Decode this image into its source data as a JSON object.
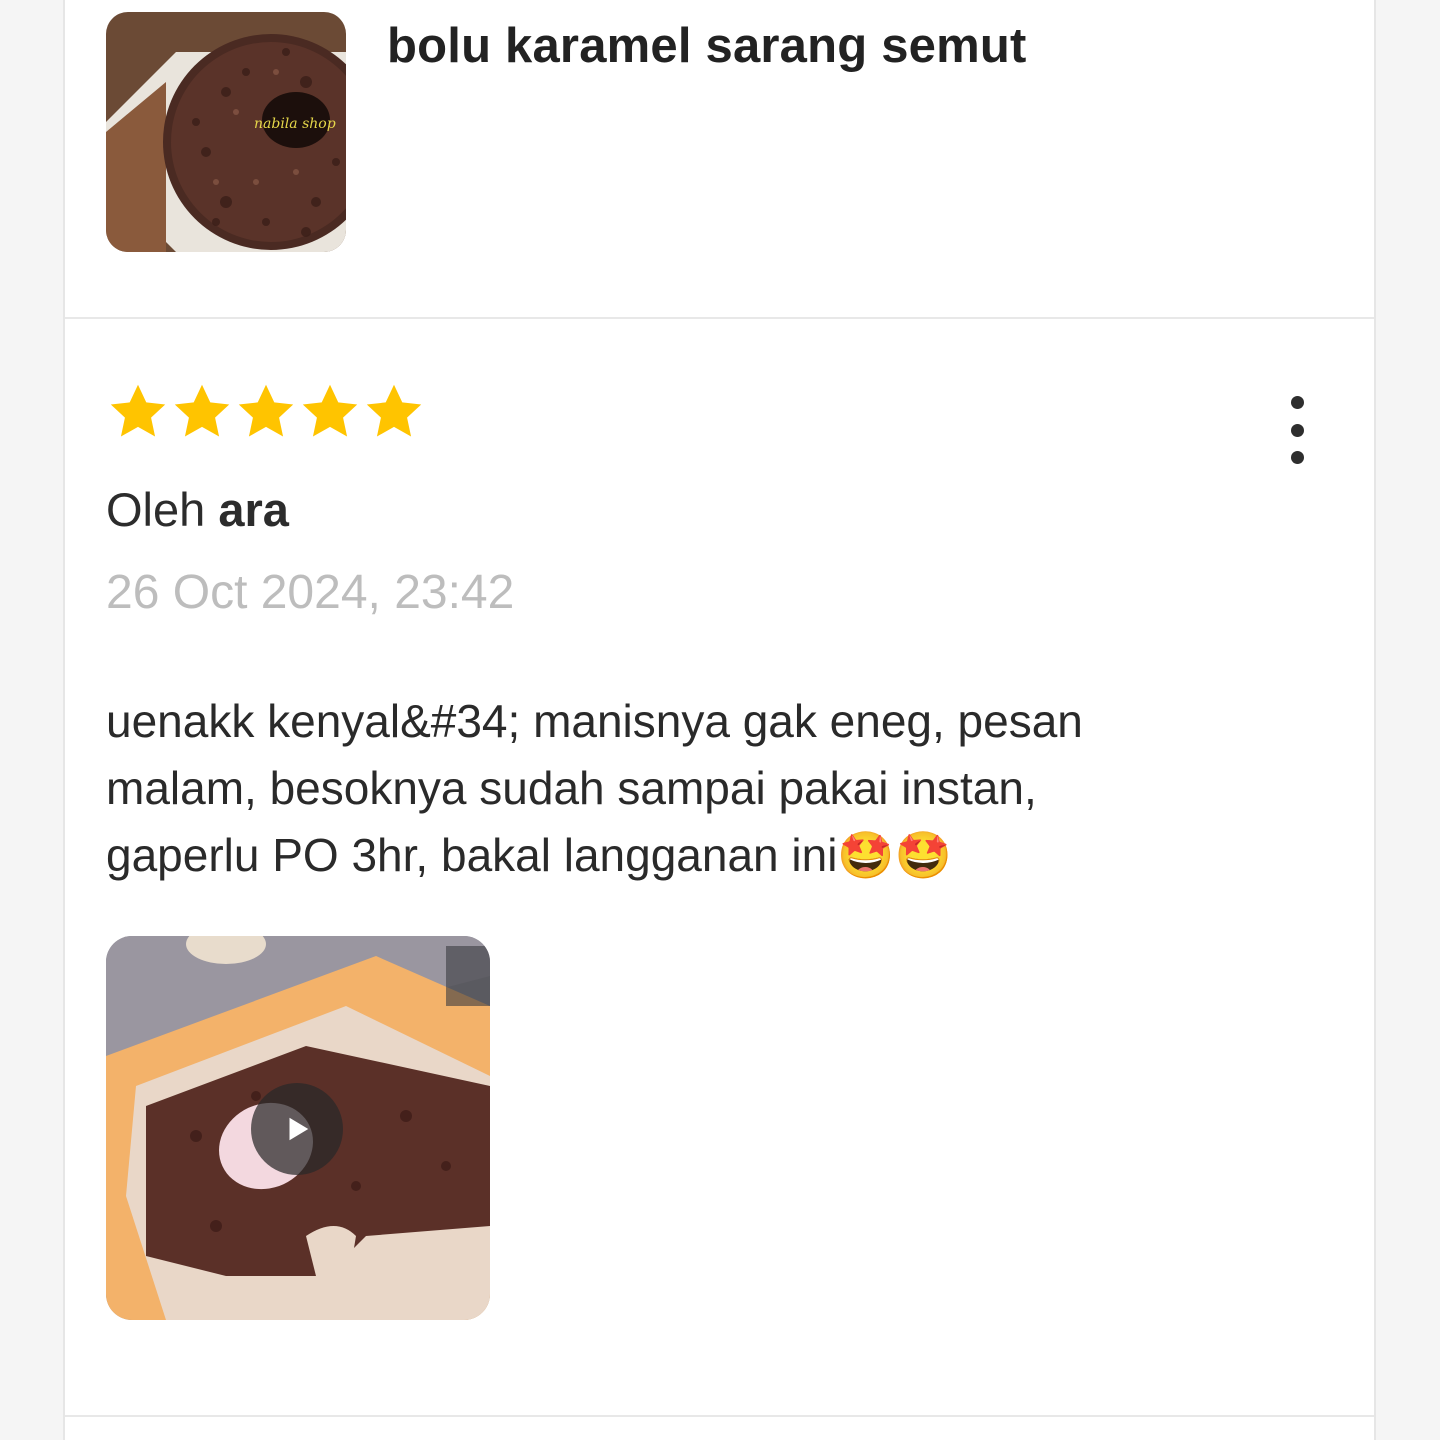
{
  "product": {
    "title": "bolu karamel sarang semut",
    "thumbnail_watermark": "nabila shop"
  },
  "review": {
    "rating": 5,
    "rating_max": 5,
    "by_prefix": "Oleh ",
    "user": "ara",
    "date": "26 Oct 2024, 23:42",
    "text_lines": [
      "uenakk kenyal&#34; manisnya gak eneg, pesan",
      "malam, besoknya sudah sampai pakai instan,",
      "gaperlu PO 3hr, bakal langganan ini🤩🤩"
    ],
    "media": {
      "type": "video",
      "icon": "play-icon"
    },
    "menu_icon": "more-vertical-icon"
  },
  "colors": {
    "star": "#FFC400",
    "text": "#2a2a2a",
    "muted": "#bdbdbd",
    "divider": "#e8e8e8"
  }
}
